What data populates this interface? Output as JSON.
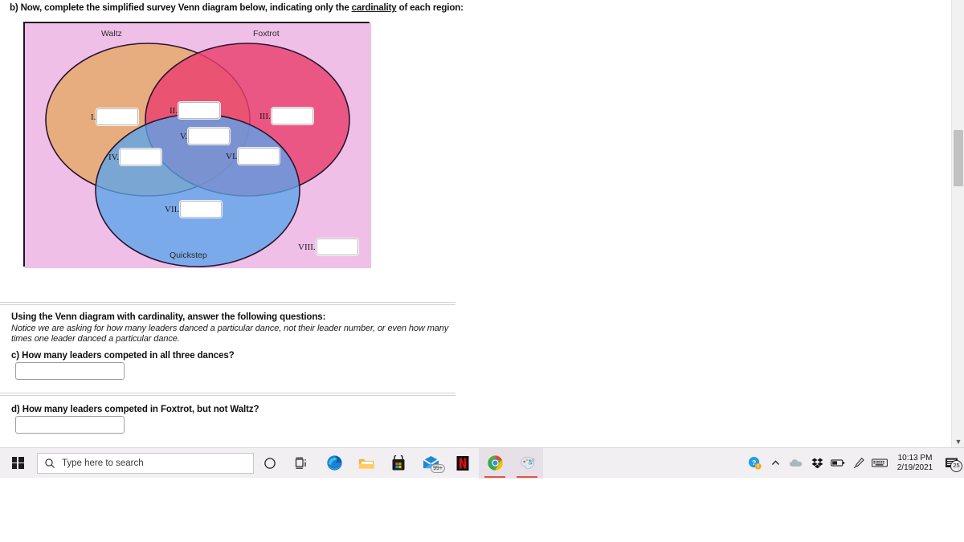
{
  "question_b": {
    "prefix": "b) Now, complete the simplified survey Venn diagram below, indicating only the ",
    "underlined": "cardinality",
    "suffix": " of each region:"
  },
  "venn": {
    "background_color": "#efbfe8",
    "border_color": "#221024",
    "circles": [
      {
        "label": "Waltz",
        "color": "#e9b179"
      },
      {
        "label": "Foxtrot",
        "color": "#ee5b84"
      },
      {
        "label": "Quickstep",
        "color": "#86bdee"
      }
    ],
    "region_colors": {
      "waltz_only": "#edbc82",
      "waltz_foxtrot": "#ec5d54",
      "foxtrot_only": "#ee5b84",
      "waltz_quickstep": "#82c3be",
      "all_three": "#7a8aa5",
      "foxtrot_quickstep": "#7d8fc8",
      "quickstep_only": "#86bdee",
      "outside": "#efbfe8"
    },
    "regions": [
      {
        "numeral": "I.",
        "value": "",
        "region": "waltz-only"
      },
      {
        "numeral": "II.",
        "value": "",
        "region": "waltz-foxtrot"
      },
      {
        "numeral": "III.",
        "value": "",
        "region": "foxtrot-only"
      },
      {
        "numeral": "IV.",
        "value": "",
        "region": "waltz-quickstep"
      },
      {
        "numeral": "V.",
        "value": "",
        "region": "all-three"
      },
      {
        "numeral": "VI.",
        "value": "",
        "region": "foxtrot-quickstep"
      },
      {
        "numeral": "VII.",
        "value": "",
        "region": "quickstep-only"
      },
      {
        "numeral": "VIII.",
        "value": "",
        "region": "outside-all"
      }
    ]
  },
  "instructions": {
    "bold": "Using the Venn diagram with cardinality, answer the following questions:",
    "italic": "Notice we are asking for how many leaders danced a particular dance, not their leader number, or even how many times one leader danced a particular dance."
  },
  "question_c": {
    "text": "c) How many leaders competed in all three dances?",
    "value": ""
  },
  "question_d": {
    "text": "d) How many leaders competed in Foxtrot, but not Waltz?",
    "value": ""
  },
  "taskbar": {
    "search_placeholder": "Type here to search",
    "apps": [
      {
        "name": "cortana",
        "label": "Cortana"
      },
      {
        "name": "task-view",
        "label": "Task View"
      },
      {
        "name": "edge",
        "label": "Microsoft Edge"
      },
      {
        "name": "file-explorer",
        "label": "File Explorer"
      },
      {
        "name": "microsoft-store",
        "label": "Microsoft Store"
      },
      {
        "name": "mail",
        "label": "Mail",
        "badge": "99+"
      },
      {
        "name": "netflix",
        "label": "Netflix",
        "glyph": "N"
      },
      {
        "name": "chrome",
        "label": "Google Chrome",
        "active": true
      },
      {
        "name": "paint-3d",
        "label": "Paint 3D",
        "active": true
      }
    ],
    "tray": {
      "icons": [
        "help-warning-icon",
        "chevron-up-icon",
        "onedrive-icon",
        "dropbox-icon",
        "battery-icon",
        "pen-icon",
        "touch-keyboard-icon"
      ],
      "time": "10:13 PM",
      "date": "2/19/2021",
      "notification_count": "25"
    }
  }
}
